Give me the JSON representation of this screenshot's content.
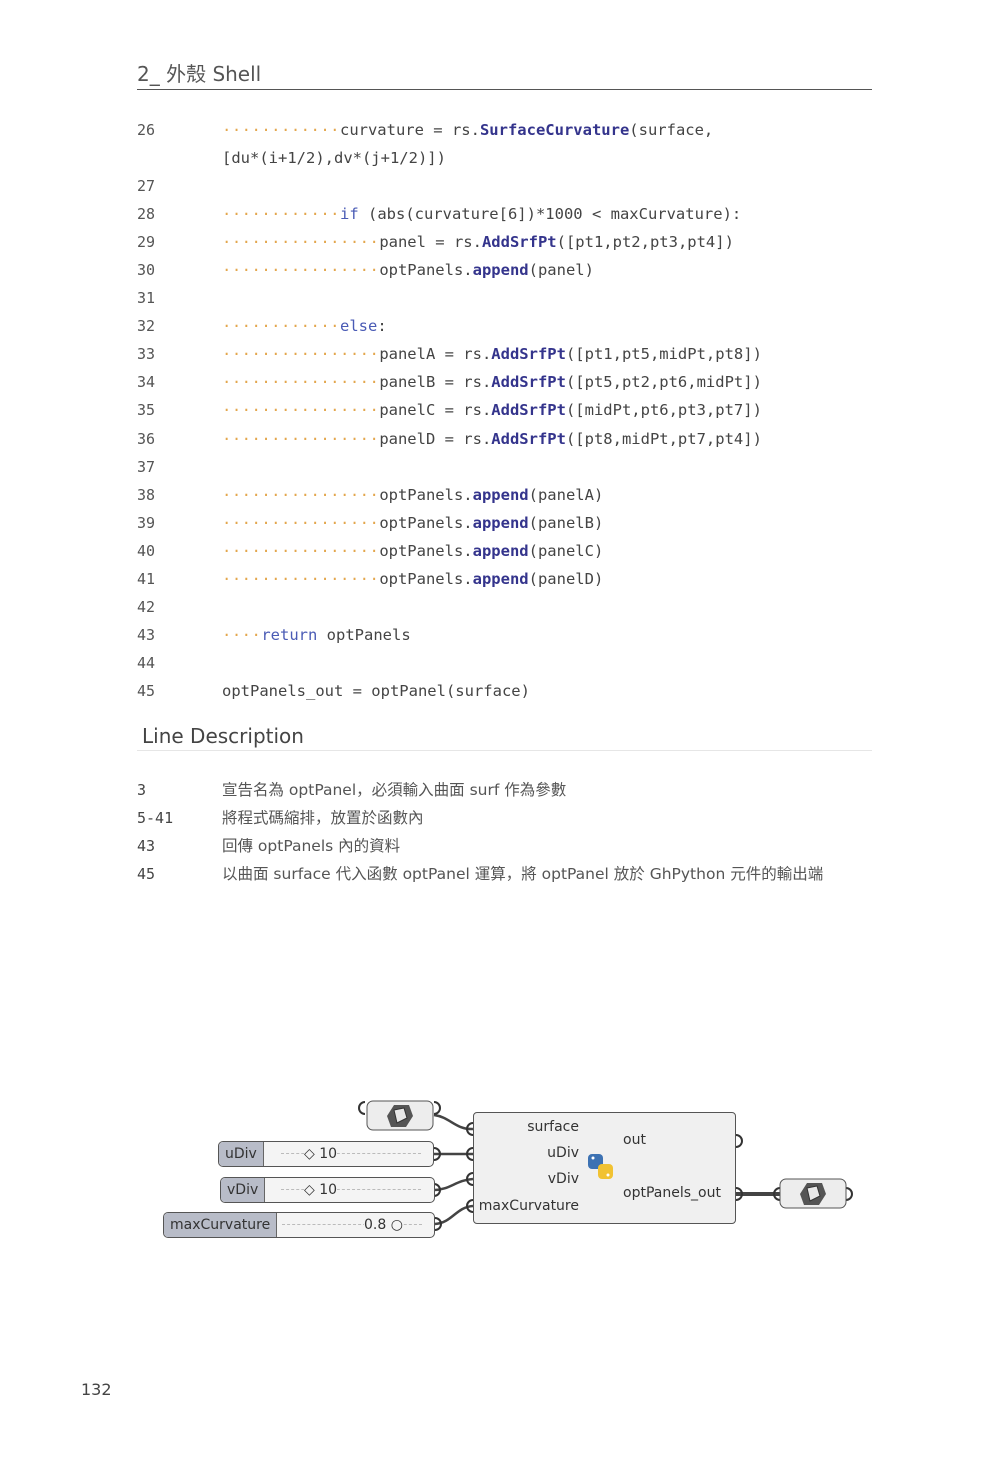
{
  "header": {
    "title": "2_ 外殼  Shell"
  },
  "code_lines": [
    {
      "n": "26",
      "dots": "············",
      "parts": [
        [
          "t",
          "curvature = rs."
        ],
        [
          "f",
          "SurfaceCurvature"
        ],
        [
          "t",
          "(surface,"
        ]
      ]
    },
    {
      "n": "",
      "dots": "",
      "parts": [
        [
          "t",
          "[du*(i+1/2),dv*(j+1/2)])"
        ]
      ]
    },
    {
      "n": "27",
      "dots": "",
      "parts": []
    },
    {
      "n": "28",
      "dots": "············",
      "parts": [
        [
          "k",
          "if"
        ],
        [
          "t",
          " (abs(curvature[6])*1000 < maxCurvature):"
        ]
      ]
    },
    {
      "n": "29",
      "dots": "················",
      "parts": [
        [
          "t",
          "panel = rs."
        ],
        [
          "f",
          "AddSrfPt"
        ],
        [
          "t",
          "([pt1,pt2,pt3,pt4])"
        ]
      ]
    },
    {
      "n": "30",
      "dots": "················",
      "parts": [
        [
          "t",
          "optPanels."
        ],
        [
          "f",
          "append"
        ],
        [
          "t",
          "(panel)"
        ]
      ]
    },
    {
      "n": "31",
      "dots": "",
      "parts": []
    },
    {
      "n": "32",
      "dots": "············",
      "parts": [
        [
          "k",
          "else"
        ],
        [
          "t",
          ":"
        ]
      ]
    },
    {
      "n": "33",
      "dots": "················",
      "parts": [
        [
          "t",
          "panelA = rs."
        ],
        [
          "f",
          "AddSrfPt"
        ],
        [
          "t",
          "([pt1,pt5,midPt,pt8])"
        ]
      ]
    },
    {
      "n": "34",
      "dots": "················",
      "parts": [
        [
          "t",
          "panelB = rs."
        ],
        [
          "f",
          "AddSrfPt"
        ],
        [
          "t",
          "([pt5,pt2,pt6,midPt])"
        ]
      ]
    },
    {
      "n": "35",
      "dots": "················",
      "parts": [
        [
          "t",
          "panelC = rs."
        ],
        [
          "f",
          "AddSrfPt"
        ],
        [
          "t",
          "([midPt,pt6,pt3,pt7])"
        ]
      ]
    },
    {
      "n": "36",
      "dots": "················",
      "parts": [
        [
          "t",
          "panelD = rs."
        ],
        [
          "f",
          "AddSrfPt"
        ],
        [
          "t",
          "([pt8,midPt,pt7,pt4])"
        ]
      ]
    },
    {
      "n": "37",
      "dots": "",
      "parts": []
    },
    {
      "n": "38",
      "dots": "················",
      "parts": [
        [
          "t",
          "optPanels."
        ],
        [
          "f",
          "append"
        ],
        [
          "t",
          "(panelA)"
        ]
      ]
    },
    {
      "n": "39",
      "dots": "················",
      "parts": [
        [
          "t",
          "optPanels."
        ],
        [
          "f",
          "append"
        ],
        [
          "t",
          "(panelB)"
        ]
      ]
    },
    {
      "n": "40",
      "dots": "················",
      "parts": [
        [
          "t",
          "optPanels."
        ],
        [
          "f",
          "append"
        ],
        [
          "t",
          "(panelC)"
        ]
      ]
    },
    {
      "n": "41",
      "dots": "················",
      "parts": [
        [
          "t",
          "optPanels."
        ],
        [
          "f",
          "append"
        ],
        [
          "t",
          "(panelD)"
        ]
      ]
    },
    {
      "n": "42",
      "dots": "",
      "parts": []
    },
    {
      "n": "43",
      "dots": "····",
      "parts": [
        [
          "k",
          "return"
        ],
        [
          "t",
          " optPanels"
        ]
      ]
    },
    {
      "n": "44",
      "dots": "",
      "parts": []
    },
    {
      "n": "45",
      "dots": "",
      "parts": [
        [
          "t",
          "optPanels_out = optPanel(surface)"
        ]
      ]
    }
  ],
  "line_description": {
    "title": "Line Description",
    "rows": [
      {
        "n": "3",
        "text": "宣告名為 optPanel，必須輸入曲面 surf 作為參數"
      },
      {
        "n": "5-41",
        "text": "將程式碼縮排，放置於函數內"
      },
      {
        "n": "43",
        "text": "回傳 optPanels 內的資料"
      },
      {
        "n": "45",
        "text": "以曲面 surface 代入函數 optPanel 運算，將 optPanel 放於 GhPython 元件的輸出端"
      }
    ]
  },
  "gh": {
    "udiv": {
      "label": "uDiv",
      "value": "◇ 10"
    },
    "vdiv": {
      "label": "vDiv",
      "value": "◇ 10"
    },
    "maxc": {
      "label": "maxCurvature",
      "value": "0.8 ○"
    },
    "inputs": [
      "surface",
      "uDiv",
      "vDiv",
      "maxCurvature"
    ],
    "outputs": [
      "out",
      "optPanels_out"
    ]
  },
  "page_number": "132"
}
